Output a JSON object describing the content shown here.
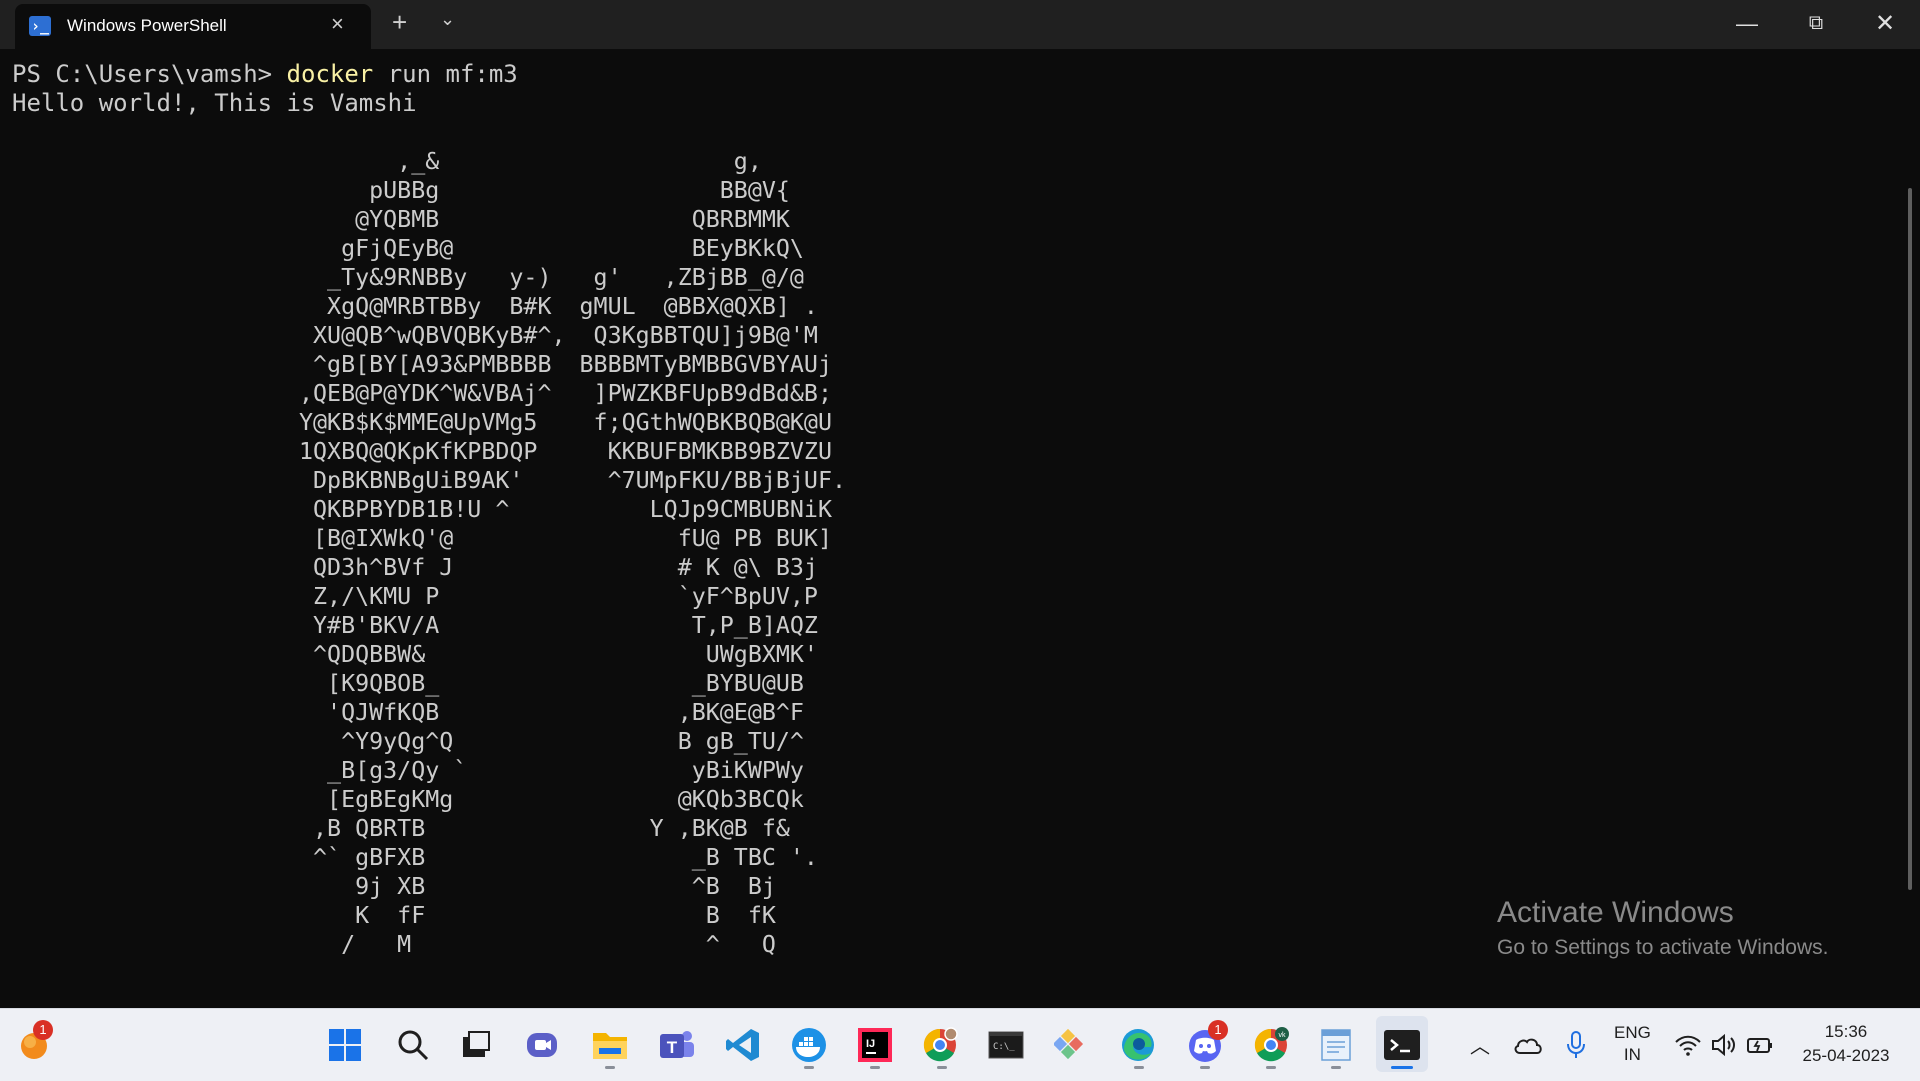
{
  "window": {
    "tab_title": "Windows PowerShell",
    "tab_close": "×",
    "new_tab": "+",
    "dropdown": "⌄",
    "minimize": "—",
    "maximize": "⧉",
    "close": "✕"
  },
  "terminal": {
    "prompt": "PS C:\\Users\\vamsh> ",
    "command": "docker",
    "command_args": " run mf:m3",
    "output_line": "Hello world!, This is Vamshi",
    "ascii_art": "       ,_&                     g,\n     pUBBg                    BB@V{\n    @YQBMB                  QBRBMMK\n   gFjQEyB@                 BEyBKkQ\\\n  _Ty&9RNBBy   y-)   g'   ,ZBjBB_@/@\n  XgQ@MRBTBBy  B#K  gMUL  @BBX@QXB] .\n XU@QB^wQBVQBKyB#^,  Q3KgBBTQU]j9B@'M\n ^gB[BY[A93&PMBBBB  BBBBMTyBMBBGVBYAUj\n,QEB@P@YDK^W&VBAj^   ]PWZKBFUpB9dBd&B;\nY@KB$K$MME@UpVMg5    f;QGthWQBKBQB@K@U\n1QXBQ@QKpKfKPBDQP     KKBUFBMKBB9BZVZU\n DpBKBNBgUiB9AK'      ^7UMpFKU/BBjBjUF.\n QKBPBYDB1B!U ^          LQJp9CMBUBNiK\n [B@IXWkQ'@                fU@ PB BUK]\n QD3h^BVf J                # K @\\ B3j\n Z,/\\KMU P                 `yF^BpUV,P\n Y#B'BKV/A                  T,P_B]AQZ\n ^QDQBBW&                    UWgBXMK'\n  [K9QBOB_                  _BYBU@UB\n  'QJWfKQB                 ,BK@E@B^F\n   ^Y9yQg^Q                B gB_TU/^\n  _B[g3/Qy `                yBiKWPWy\n  [EgBEgKMg                @KQb3BCQk\n ,B QBRTB                Y ,BK@B f&\n ^` gBFXB                   _B TBC '.\n    9j XB                   ^B  Bj\n    K  fF                    B  fK\n   /   M                     ^   Q"
  },
  "watermark": {
    "title": "Activate Windows",
    "subtitle": "Go to Settings to activate Windows."
  },
  "taskbar": {
    "apps": [
      "start-menu",
      "search",
      "task-view",
      "meet-chat",
      "file-explorer",
      "teams",
      "vs-code",
      "docker-desktop",
      "intellij-idea",
      "chrome-profile",
      "command-prompt",
      "git",
      "edge",
      "discord",
      "chrome-vk",
      "notepad",
      "windows-terminal"
    ],
    "badges": {
      "left_widget": "1",
      "discord": "1"
    },
    "tray": {
      "language_top": "ENG",
      "language_bottom": "IN",
      "time": "15:36",
      "date": "25-04-2023"
    }
  },
  "colors": {
    "terminal_bg": "#0c0c0c",
    "terminal_text": "#cccccc",
    "command_highlight": "#f9f1a5",
    "titlebar_bg": "#202020",
    "taskbar_bg": "#eef0f5",
    "accent": "#1a73e8"
  }
}
